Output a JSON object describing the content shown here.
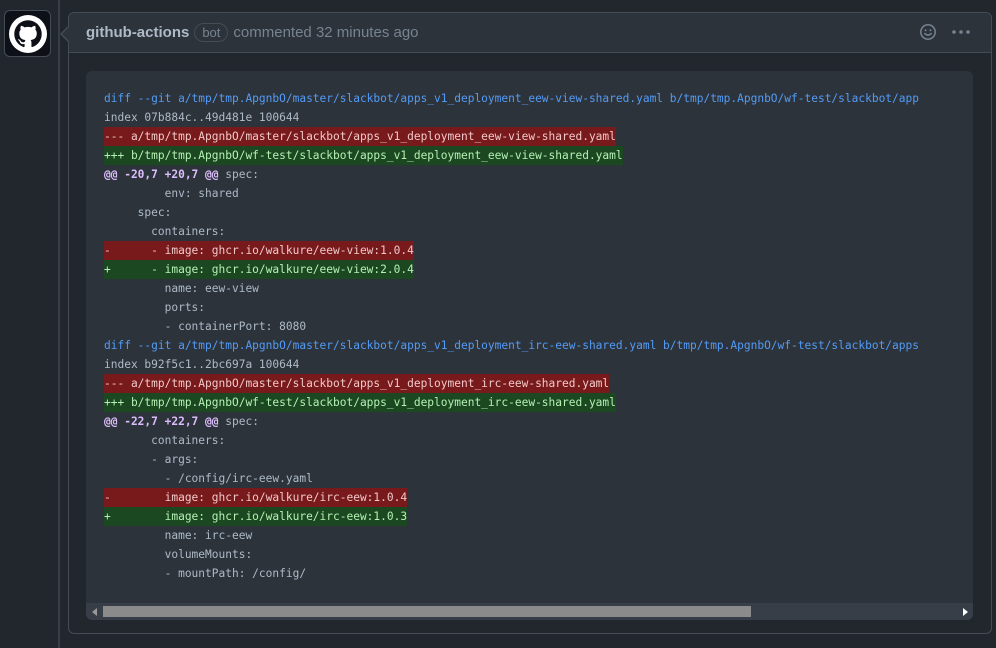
{
  "comment": {
    "author": "github-actions",
    "badge": "bot",
    "meta": "commented 32 minutes ago",
    "icons": {
      "avatar": "github-octocat-icon",
      "reaction": "smiley-icon",
      "more": "kebab-horizontal-icon",
      "scroll_left": "triangle-left-icon",
      "scroll_right": "triangle-right-icon"
    },
    "colors": {
      "deleted_bg": "#78191b",
      "added_bg": "#1b4721",
      "meta_text": "#539bf5"
    },
    "code": {
      "lines": [
        {
          "type": "meta",
          "text": "diff --git a/tmp/tmp.ApgnbO/master/slackbot/apps_v1_deployment_eew-view-shared.yaml b/tmp/tmp.ApgnbO/wf-test/slackbot/app"
        },
        {
          "type": "ctx",
          "text": "index 07b884c..49d481e 100644"
        },
        {
          "type": "del",
          "text": "--- a/tmp/tmp.ApgnbO/master/slackbot/apps_v1_deployment_eew-view-shared.yaml"
        },
        {
          "type": "add",
          "text": "+++ b/tmp/tmp.ApgnbO/wf-test/slackbot/apps_v1_deployment_eew-view-shared.yaml"
        },
        {
          "type": "hunk",
          "marker": "@@ -20,7 +20,7 @@",
          "text": " spec:"
        },
        {
          "type": "ctx",
          "text": "         env: shared"
        },
        {
          "type": "ctx",
          "text": "     spec:"
        },
        {
          "type": "ctx",
          "text": "       containers:"
        },
        {
          "type": "del",
          "text": "-      - image: ghcr.io/walkure/eew-view:1.0.4"
        },
        {
          "type": "add",
          "text": "+      - image: ghcr.io/walkure/eew-view:2.0.4"
        },
        {
          "type": "ctx",
          "text": "         name: eew-view"
        },
        {
          "type": "ctx",
          "text": "         ports:"
        },
        {
          "type": "ctx",
          "text": "         - containerPort: 8080"
        },
        {
          "type": "meta",
          "text": "diff --git a/tmp/tmp.ApgnbO/master/slackbot/apps_v1_deployment_irc-eew-shared.yaml b/tmp/tmp.ApgnbO/wf-test/slackbot/apps"
        },
        {
          "type": "ctx",
          "text": "index b92f5c1..2bc697a 100644"
        },
        {
          "type": "del",
          "text": "--- a/tmp/tmp.ApgnbO/master/slackbot/apps_v1_deployment_irc-eew-shared.yaml"
        },
        {
          "type": "add",
          "text": "+++ b/tmp/tmp.ApgnbO/wf-test/slackbot/apps_v1_deployment_irc-eew-shared.yaml"
        },
        {
          "type": "hunk",
          "marker": "@@ -22,7 +22,7 @@",
          "text": " spec:"
        },
        {
          "type": "ctx",
          "text": "       containers:"
        },
        {
          "type": "ctx",
          "text": "       - args:"
        },
        {
          "type": "ctx",
          "text": "         - /config/irc-eew.yaml"
        },
        {
          "type": "del",
          "text": "-        image: ghcr.io/walkure/irc-eew:1.0.4"
        },
        {
          "type": "add",
          "text": "+        image: ghcr.io/walkure/irc-eew:1.0.3"
        },
        {
          "type": "ctx",
          "text": "         name: irc-eew"
        },
        {
          "type": "ctx",
          "text": "         volumeMounts:"
        },
        {
          "type": "ctx",
          "text": "         - mountPath: /config/"
        }
      ]
    }
  }
}
